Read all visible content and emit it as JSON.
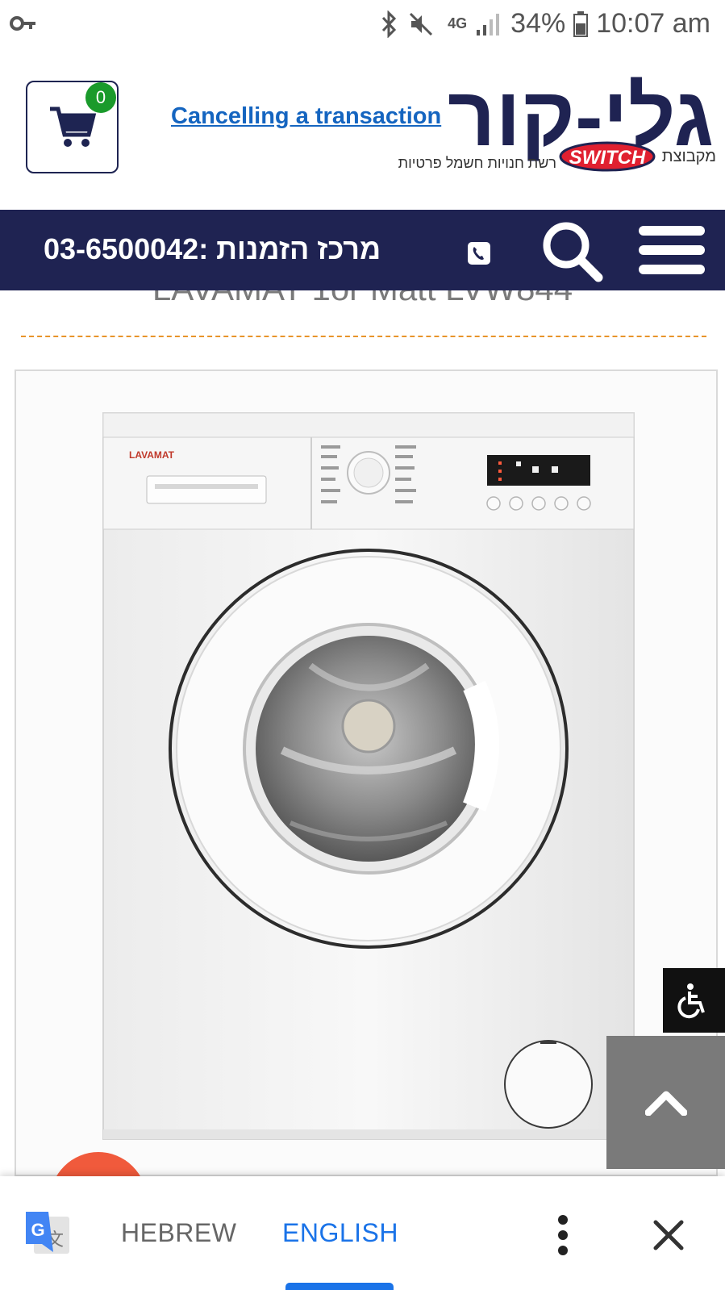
{
  "status_bar": {
    "network": "4G",
    "battery": "34%",
    "time": "10:07 am"
  },
  "header": {
    "cart_count": "0",
    "cancel_link": "Cancelling a transaction",
    "logo": {
      "brand": "גלי-קור",
      "group_prefix": "מקבוצת",
      "switch": "SWITCH",
      "tagline": "רשת חנויות חשמל פרטיות"
    }
  },
  "navbar": {
    "phone_label": "מרכז הזמנות :03-6500042"
  },
  "product": {
    "title": "LAVAMAT 1or Matt LVW844",
    "image": {
      "brand": "LAVAMAT"
    }
  },
  "translate_bar": {
    "source_lang": "HEBREW",
    "target_lang": "ENGLISH"
  },
  "colors": {
    "navy": "#1f2352",
    "link_blue": "#1565c0",
    "accent_orange": "#e8942a",
    "translate_blue": "#1a73e8",
    "badge_green": "#1a9a2b"
  }
}
